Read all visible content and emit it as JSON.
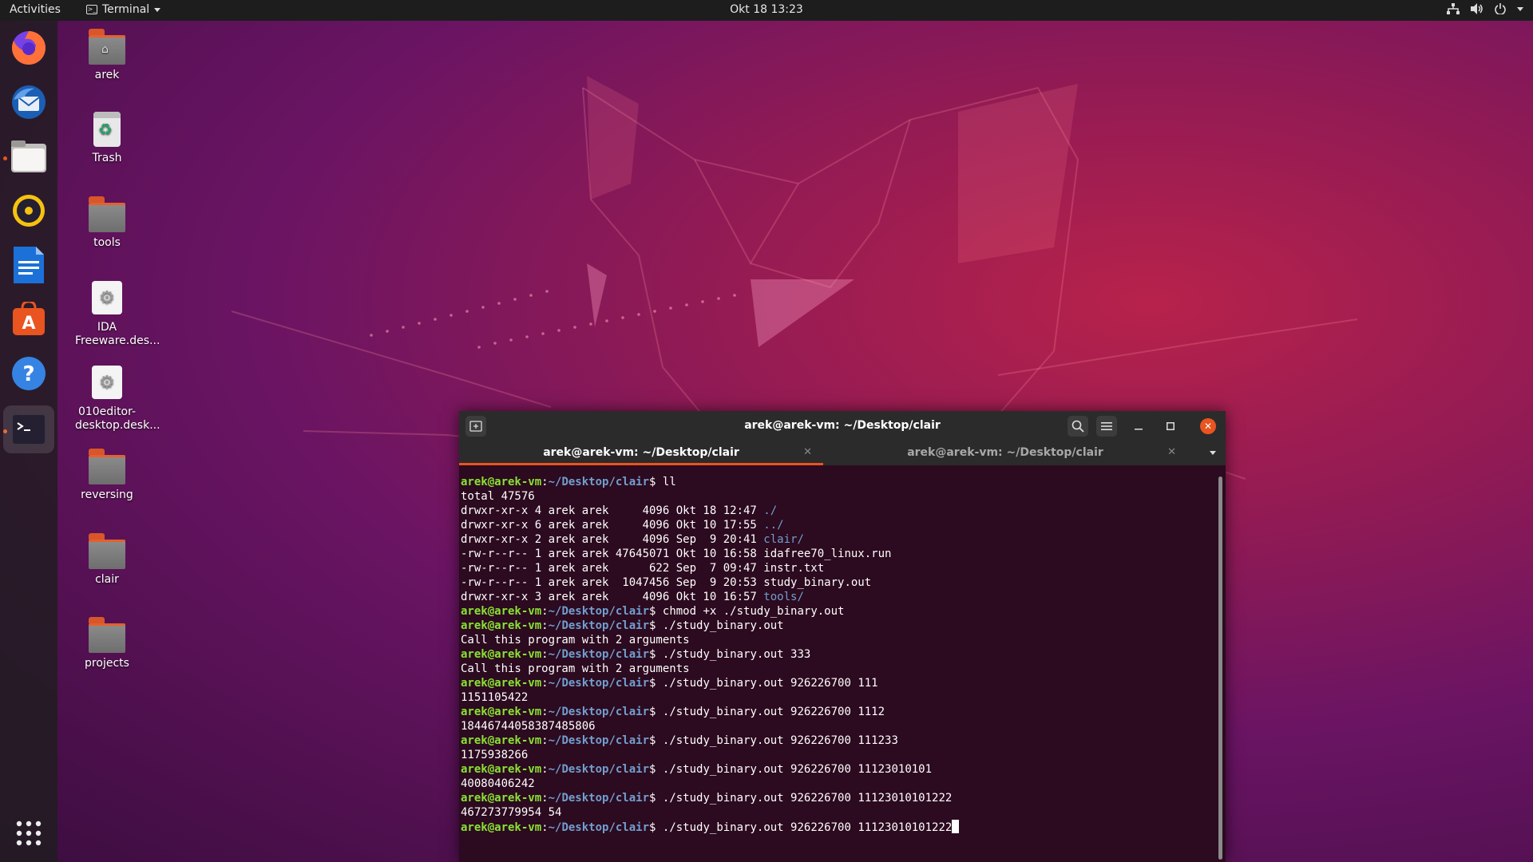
{
  "topbar": {
    "activities": "Activities",
    "app_name": "Terminal",
    "clock": "Okt 18  13:23",
    "tray_icons": [
      "network-icon",
      "volume-icon",
      "power-icon"
    ]
  },
  "dock": {
    "items": [
      {
        "name": "firefox",
        "icon": "firefox-icon"
      },
      {
        "name": "thunderbird",
        "icon": "thunderbird-icon"
      },
      {
        "name": "files",
        "icon": "files-icon",
        "running": true
      },
      {
        "name": "rhythmbox",
        "icon": "rhythmbox-icon"
      },
      {
        "name": "libreoffice-writer",
        "icon": "writer-icon"
      },
      {
        "name": "ubuntu-software",
        "icon": "software-icon"
      },
      {
        "name": "help",
        "icon": "help-icon"
      },
      {
        "name": "terminal",
        "icon": "terminal-icon",
        "running": true,
        "active": true
      }
    ],
    "show_apps_icon": "grid-icon"
  },
  "desktop": {
    "icons": [
      {
        "label": "arek",
        "type": "home-folder"
      },
      {
        "label": "Trash",
        "type": "trash"
      },
      {
        "label": "tools",
        "type": "folder"
      },
      {
        "label": "IDA Freeware.des...",
        "type": "desktop-file"
      },
      {
        "label": "010editor-desktop.desk...",
        "type": "desktop-file"
      },
      {
        "label": "reversing",
        "type": "folder"
      },
      {
        "label": "clair",
        "type": "folder"
      },
      {
        "label": "projects",
        "type": "folder"
      }
    ]
  },
  "terminal": {
    "window_title": "arek@arek-vm: ~/Desktop/clair",
    "tabs": [
      {
        "label": "arek@arek-vm: ~/Desktop/clair",
        "active": true
      },
      {
        "label": "arek@arek-vm: ~/Desktop/clair",
        "active": false
      }
    ],
    "prompt_user": "arek@arek-vm",
    "prompt_path": "~/Desktop/clair",
    "lines": [
      {
        "type": "cmd",
        "text": "ll"
      },
      {
        "type": "out",
        "text": "total 47576"
      },
      {
        "type": "ls",
        "pre": "drwxr-xr-x 4 arek arek     4096 Okt 18 12:47 ",
        "name": "./",
        "dir": true
      },
      {
        "type": "ls",
        "pre": "drwxr-xr-x 6 arek arek     4096 Okt 10 17:55 ",
        "name": "../",
        "dir": true
      },
      {
        "type": "ls",
        "pre": "drwxr-xr-x 2 arek arek     4096 Sep  9 20:41 ",
        "name": "clair/",
        "dir": true
      },
      {
        "type": "ls",
        "pre": "-rw-r--r-- 1 arek arek 47645071 Okt 10 16:58 ",
        "name": "idafree70_linux.run",
        "dir": false
      },
      {
        "type": "ls",
        "pre": "-rw-r--r-- 1 arek arek      622 Sep  7 09:47 ",
        "name": "instr.txt",
        "dir": false
      },
      {
        "type": "ls",
        "pre": "-rw-r--r-- 1 arek arek  1047456 Sep  9 20:53 ",
        "name": "study_binary.out",
        "dir": false
      },
      {
        "type": "ls",
        "pre": "drwxr-xr-x 3 arek arek     4096 Okt 10 16:57 ",
        "name": "tools/",
        "dir": true
      },
      {
        "type": "cmd",
        "text": "chmod +x ./study_binary.out"
      },
      {
        "type": "cmd",
        "text": "./study_binary.out"
      },
      {
        "type": "out",
        "text": "Call this program with 2 arguments"
      },
      {
        "type": "cmd",
        "text": "./study_binary.out 333"
      },
      {
        "type": "out",
        "text": "Call this program with 2 arguments"
      },
      {
        "type": "cmd",
        "text": "./study_binary.out 926226700 111"
      },
      {
        "type": "out",
        "text": "1151105422"
      },
      {
        "type": "cmd",
        "text": "./study_binary.out 926226700 1112"
      },
      {
        "type": "out",
        "text": "18446744058387485806"
      },
      {
        "type": "cmd",
        "text": "./study_binary.out 926226700 111233"
      },
      {
        "type": "out",
        "text": "1175938266"
      },
      {
        "type": "cmd",
        "text": "./study_binary.out 926226700 11123010101"
      },
      {
        "type": "out",
        "text": "40080406242"
      },
      {
        "type": "cmd",
        "text": "./study_binary.out 926226700 11123010101222"
      },
      {
        "type": "out",
        "text": "467273779954 54"
      },
      {
        "type": "cmd",
        "text": "./study_binary.out 926226700 11123010101222",
        "cursor": true
      }
    ]
  }
}
